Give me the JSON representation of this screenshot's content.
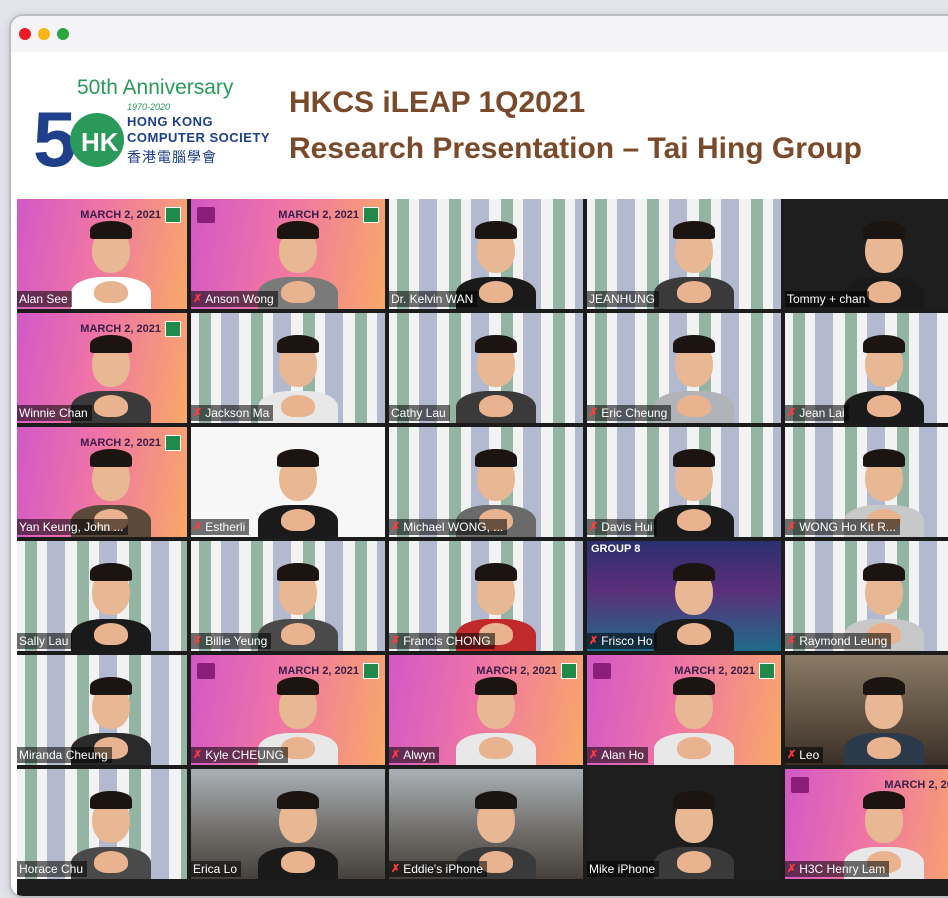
{
  "window": {
    "controls": [
      "close",
      "minimize",
      "maximize"
    ]
  },
  "header": {
    "anniversary": "50th Anniversary",
    "years": "1970-2020",
    "logo_mark": "50 HKCS",
    "org_line1": "HONG KONG",
    "org_line2": "COMPUTER SOCIETY",
    "org_chinese": "香港電腦學會",
    "title_line1": "HKCS iLEAP 1Q2021",
    "title_line2": "Research Presentation – Tai Hing Group"
  },
  "date_badge": "MARCH 2, 2021",
  "date_badge_short": "MARCH 2, 2021",
  "date_badge_cut": "MARCH 2, 202",
  "group_label": "GROUP 8",
  "colors": {
    "title_brown": "#7a4a2a",
    "logo_blue": "#1e3f8a",
    "logo_green": "#2a9a5a",
    "mute_red": "#ff3b3b"
  },
  "participants": [
    {
      "name": "Alan See",
      "muted": false
    },
    {
      "name": "Anson Wong",
      "muted": true
    },
    {
      "name": "Dr. Kelvin WAN",
      "muted": false
    },
    {
      "name": "JEANHUNG",
      "muted": false
    },
    {
      "name": "Tommy + chan",
      "muted": false
    },
    {
      "name": "Winnie Chan",
      "muted": false
    },
    {
      "name": "Jackson Ma",
      "muted": true
    },
    {
      "name": "Cathy Lau",
      "muted": false
    },
    {
      "name": "Eric Cheung",
      "muted": true
    },
    {
      "name": "Jean Lai",
      "muted": true
    },
    {
      "name": "Yan Keung, John ...",
      "muted": false
    },
    {
      "name": "Estherli",
      "muted": true
    },
    {
      "name": "Michael WONG, ...",
      "muted": true
    },
    {
      "name": "Davis Hui",
      "muted": true
    },
    {
      "name": "WONG Ho Kit R...",
      "muted": true
    },
    {
      "name": "Sally Lau",
      "muted": false
    },
    {
      "name": "Billie Yeung",
      "muted": true
    },
    {
      "name": "Francis CHONG",
      "muted": true
    },
    {
      "name": "Frisco Ho",
      "muted": true
    },
    {
      "name": "Raymond Leung",
      "muted": true
    },
    {
      "name": "Miranda Cheung",
      "muted": false
    },
    {
      "name": "Kyle CHEUNG",
      "muted": true
    },
    {
      "name": "Alwyn",
      "muted": true
    },
    {
      "name": "Alan Ho",
      "muted": true
    },
    {
      "name": "Leo",
      "muted": true
    },
    {
      "name": "Horace Chu",
      "muted": false
    },
    {
      "name": "Erica Lo",
      "muted": false
    },
    {
      "name": "Eddie's iPhone",
      "muted": true
    },
    {
      "name": "Mike iPhone",
      "muted": false
    },
    {
      "name": "H3C Henry Lam",
      "muted": true
    }
  ]
}
